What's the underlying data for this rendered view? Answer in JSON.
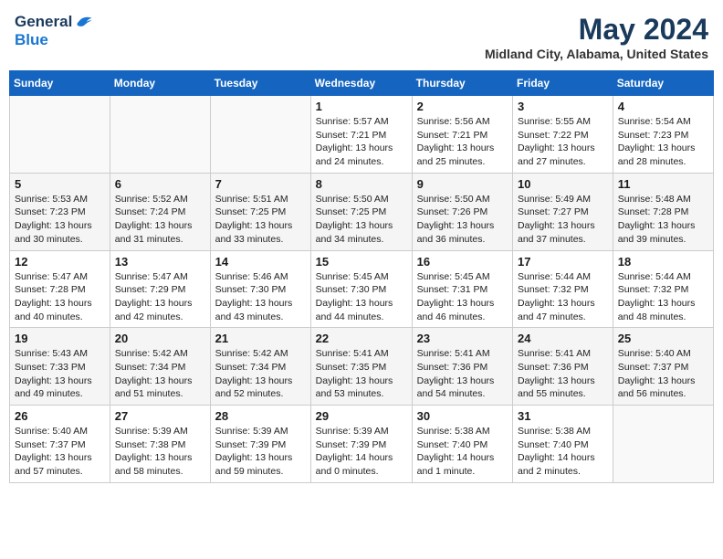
{
  "header": {
    "logo_general": "General",
    "logo_blue": "Blue",
    "month": "May 2024",
    "location": "Midland City, Alabama, United States"
  },
  "days_of_week": [
    "Sunday",
    "Monday",
    "Tuesday",
    "Wednesday",
    "Thursday",
    "Friday",
    "Saturday"
  ],
  "weeks": [
    [
      {
        "day": "",
        "info": ""
      },
      {
        "day": "",
        "info": ""
      },
      {
        "day": "",
        "info": ""
      },
      {
        "day": "1",
        "info": "Sunrise: 5:57 AM\nSunset: 7:21 PM\nDaylight: 13 hours\nand 24 minutes."
      },
      {
        "day": "2",
        "info": "Sunrise: 5:56 AM\nSunset: 7:21 PM\nDaylight: 13 hours\nand 25 minutes."
      },
      {
        "day": "3",
        "info": "Sunrise: 5:55 AM\nSunset: 7:22 PM\nDaylight: 13 hours\nand 27 minutes."
      },
      {
        "day": "4",
        "info": "Sunrise: 5:54 AM\nSunset: 7:23 PM\nDaylight: 13 hours\nand 28 minutes."
      }
    ],
    [
      {
        "day": "5",
        "info": "Sunrise: 5:53 AM\nSunset: 7:23 PM\nDaylight: 13 hours\nand 30 minutes."
      },
      {
        "day": "6",
        "info": "Sunrise: 5:52 AM\nSunset: 7:24 PM\nDaylight: 13 hours\nand 31 minutes."
      },
      {
        "day": "7",
        "info": "Sunrise: 5:51 AM\nSunset: 7:25 PM\nDaylight: 13 hours\nand 33 minutes."
      },
      {
        "day": "8",
        "info": "Sunrise: 5:50 AM\nSunset: 7:25 PM\nDaylight: 13 hours\nand 34 minutes."
      },
      {
        "day": "9",
        "info": "Sunrise: 5:50 AM\nSunset: 7:26 PM\nDaylight: 13 hours\nand 36 minutes."
      },
      {
        "day": "10",
        "info": "Sunrise: 5:49 AM\nSunset: 7:27 PM\nDaylight: 13 hours\nand 37 minutes."
      },
      {
        "day": "11",
        "info": "Sunrise: 5:48 AM\nSunset: 7:28 PM\nDaylight: 13 hours\nand 39 minutes."
      }
    ],
    [
      {
        "day": "12",
        "info": "Sunrise: 5:47 AM\nSunset: 7:28 PM\nDaylight: 13 hours\nand 40 minutes."
      },
      {
        "day": "13",
        "info": "Sunrise: 5:47 AM\nSunset: 7:29 PM\nDaylight: 13 hours\nand 42 minutes."
      },
      {
        "day": "14",
        "info": "Sunrise: 5:46 AM\nSunset: 7:30 PM\nDaylight: 13 hours\nand 43 minutes."
      },
      {
        "day": "15",
        "info": "Sunrise: 5:45 AM\nSunset: 7:30 PM\nDaylight: 13 hours\nand 44 minutes."
      },
      {
        "day": "16",
        "info": "Sunrise: 5:45 AM\nSunset: 7:31 PM\nDaylight: 13 hours\nand 46 minutes."
      },
      {
        "day": "17",
        "info": "Sunrise: 5:44 AM\nSunset: 7:32 PM\nDaylight: 13 hours\nand 47 minutes."
      },
      {
        "day": "18",
        "info": "Sunrise: 5:44 AM\nSunset: 7:32 PM\nDaylight: 13 hours\nand 48 minutes."
      }
    ],
    [
      {
        "day": "19",
        "info": "Sunrise: 5:43 AM\nSunset: 7:33 PM\nDaylight: 13 hours\nand 49 minutes."
      },
      {
        "day": "20",
        "info": "Sunrise: 5:42 AM\nSunset: 7:34 PM\nDaylight: 13 hours\nand 51 minutes."
      },
      {
        "day": "21",
        "info": "Sunrise: 5:42 AM\nSunset: 7:34 PM\nDaylight: 13 hours\nand 52 minutes."
      },
      {
        "day": "22",
        "info": "Sunrise: 5:41 AM\nSunset: 7:35 PM\nDaylight: 13 hours\nand 53 minutes."
      },
      {
        "day": "23",
        "info": "Sunrise: 5:41 AM\nSunset: 7:36 PM\nDaylight: 13 hours\nand 54 minutes."
      },
      {
        "day": "24",
        "info": "Sunrise: 5:41 AM\nSunset: 7:36 PM\nDaylight: 13 hours\nand 55 minutes."
      },
      {
        "day": "25",
        "info": "Sunrise: 5:40 AM\nSunset: 7:37 PM\nDaylight: 13 hours\nand 56 minutes."
      }
    ],
    [
      {
        "day": "26",
        "info": "Sunrise: 5:40 AM\nSunset: 7:37 PM\nDaylight: 13 hours\nand 57 minutes."
      },
      {
        "day": "27",
        "info": "Sunrise: 5:39 AM\nSunset: 7:38 PM\nDaylight: 13 hours\nand 58 minutes."
      },
      {
        "day": "28",
        "info": "Sunrise: 5:39 AM\nSunset: 7:39 PM\nDaylight: 13 hours\nand 59 minutes."
      },
      {
        "day": "29",
        "info": "Sunrise: 5:39 AM\nSunset: 7:39 PM\nDaylight: 14 hours\nand 0 minutes."
      },
      {
        "day": "30",
        "info": "Sunrise: 5:38 AM\nSunset: 7:40 PM\nDaylight: 14 hours\nand 1 minute."
      },
      {
        "day": "31",
        "info": "Sunrise: 5:38 AM\nSunset: 7:40 PM\nDaylight: 14 hours\nand 2 minutes."
      },
      {
        "day": "",
        "info": ""
      }
    ]
  ]
}
